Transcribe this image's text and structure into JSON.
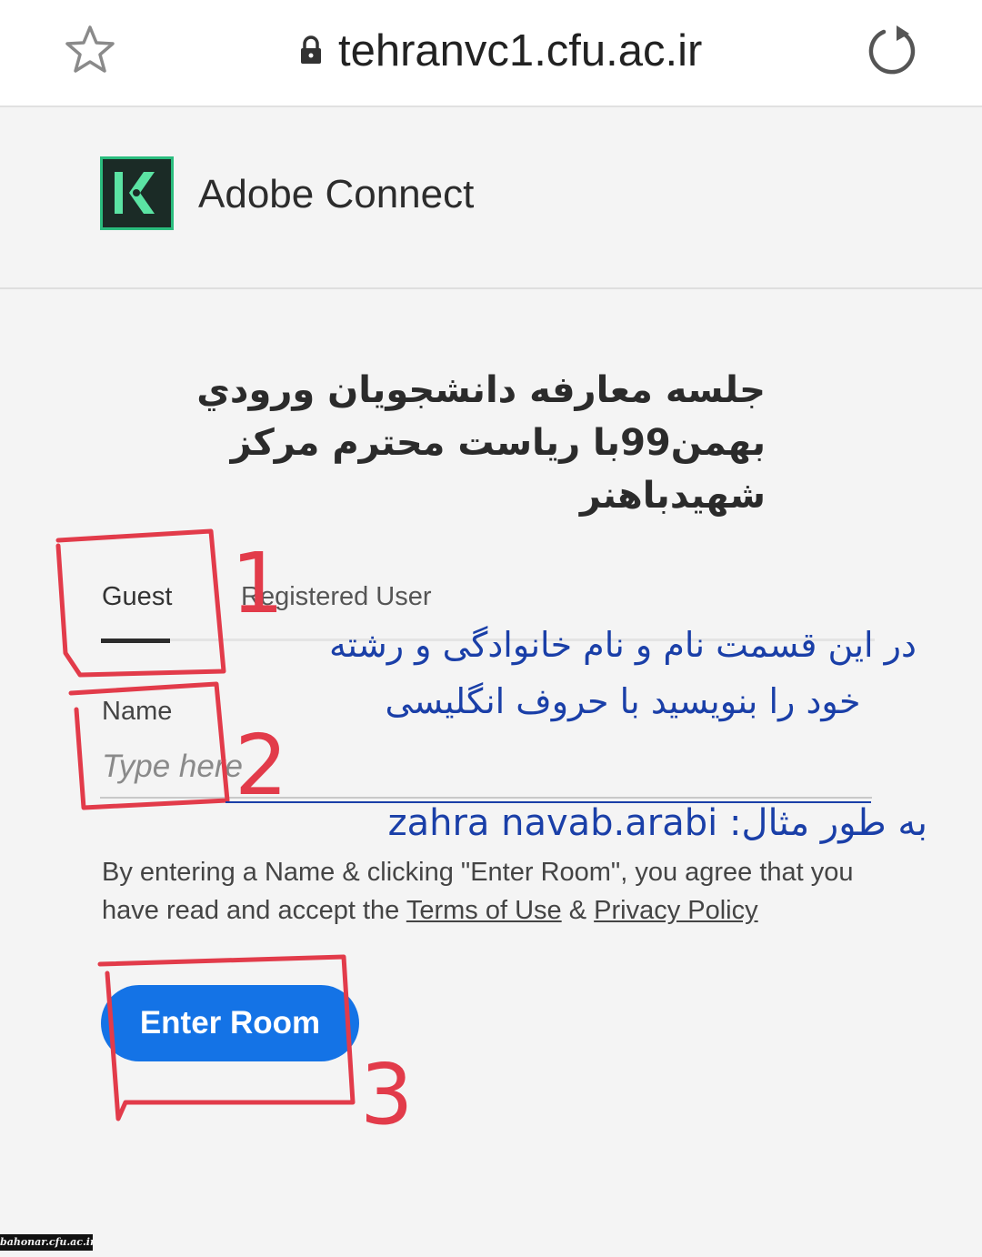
{
  "browser": {
    "url": "tehranvc1.cfu.ac.ir",
    "icons": [
      "star-icon",
      "lock-icon",
      "reload-icon"
    ]
  },
  "header": {
    "product_name": "Adobe Connect",
    "logo_icon": "adobe-connect-logo-icon"
  },
  "meeting": {
    "title": "جلسه معارفه دانشجويان ورودي بهمن99با ریاست محترم مرکز شهیدباهنر"
  },
  "tabs": [
    {
      "label": "Guest",
      "selected": true
    },
    {
      "label": "Registered User",
      "selected": false
    }
  ],
  "form": {
    "name_label": "Name",
    "name_placeholder": "Type here",
    "agree_prefix": "By entering a Name & clicking \"Enter Room\", you agree that you have read and accept the ",
    "terms_link": "Terms of Use",
    "amp": " & ",
    "privacy_link": "Privacy Policy",
    "enter_button": "Enter Room"
  },
  "annotations": {
    "note": "در این قسمت نام و نام خانوادگی و رشته خود را بنویسید با حروف انگلیسی",
    "example": "به طور مثال: zahra navab.arabi",
    "step1": "1",
    "step2": "2",
    "step3": "3",
    "annotation_color": "#e23b4a",
    "note_color": "#1a3fa8"
  },
  "colors": {
    "accent": "#1473e6",
    "logo_bg": "#1b2b26",
    "logo_border": "#2bbd7e"
  },
  "watermark": "bahonar.cfu.ac.ir"
}
